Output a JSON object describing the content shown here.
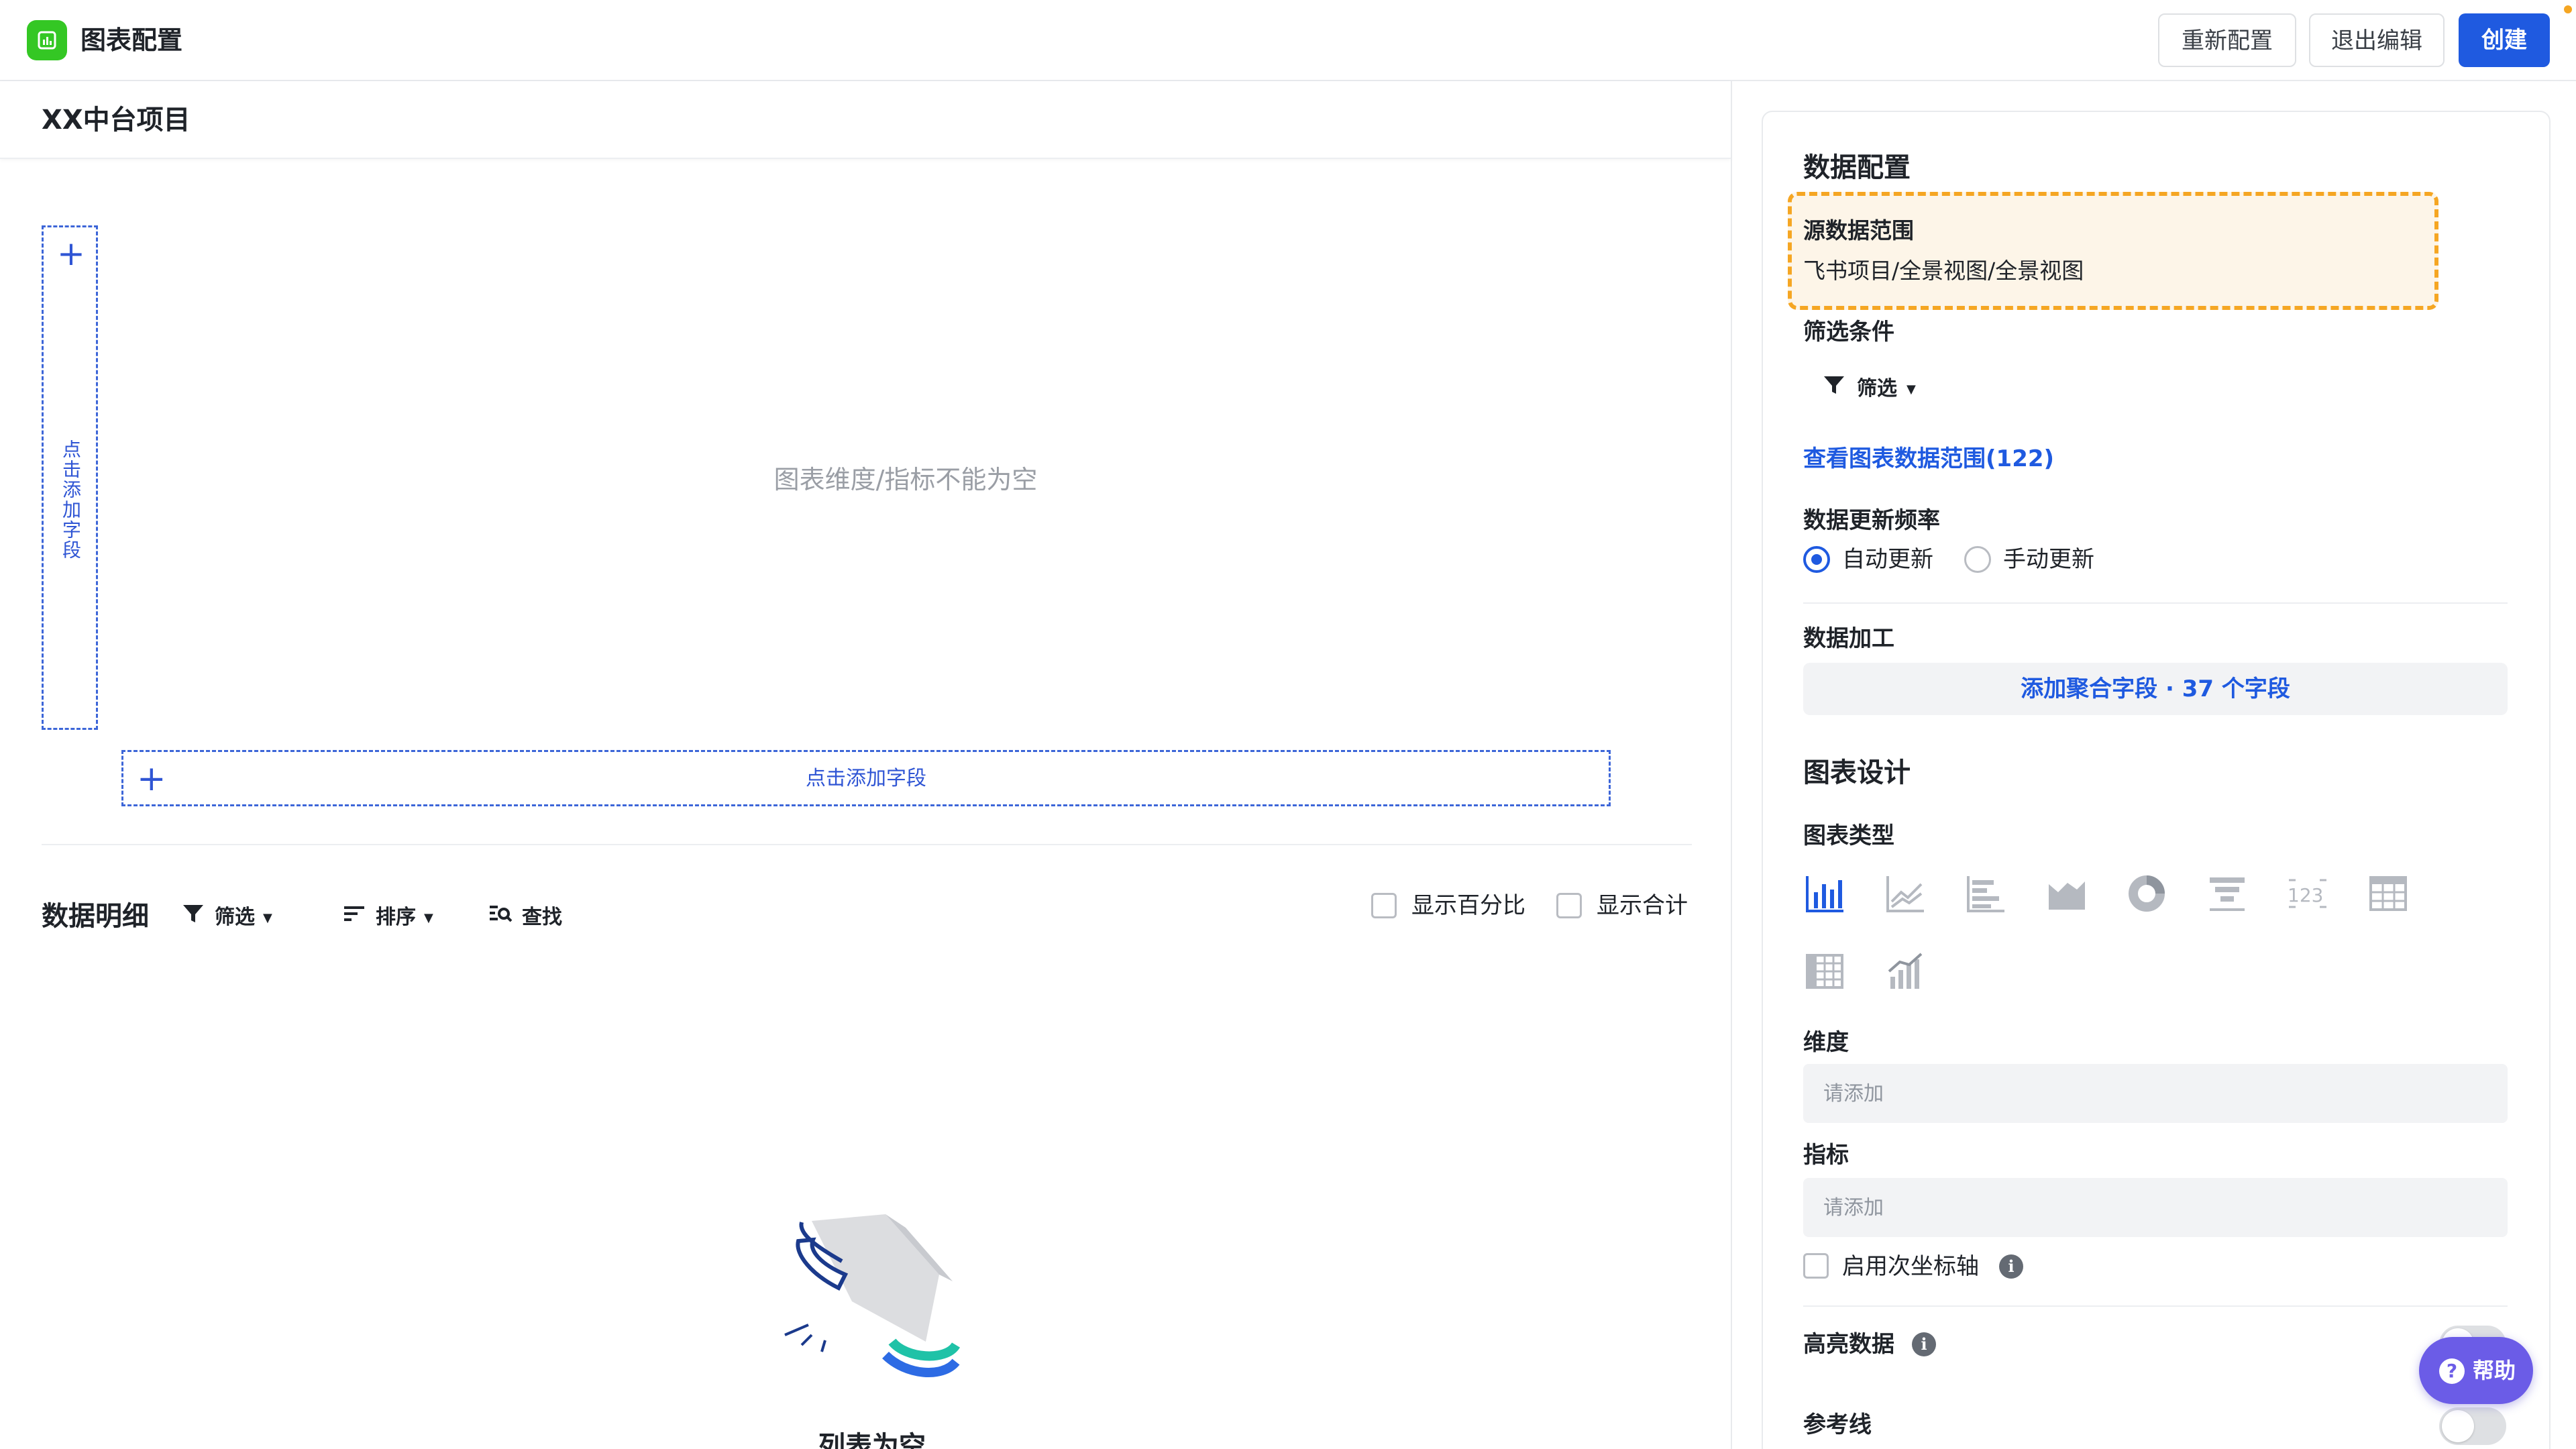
{
  "app": {
    "title": "图表配置"
  },
  "header": {
    "reset_label": "重新配置",
    "exit_label": "退出编辑",
    "create_label": "创建"
  },
  "canvas": {
    "project_title": "XX中台项目",
    "y_field_hint": "点击添加字段",
    "x_field_hint": "点击添加字段",
    "empty_chart_text": "图表维度/指标不能为空"
  },
  "details": {
    "title": "数据明细",
    "filter_label": "筛选",
    "sort_label": "排序",
    "find_label": "查找",
    "show_percent_label": "显示百分比",
    "show_total_label": "显示合计",
    "show_percent_checked": false,
    "show_total_checked": false,
    "empty_list_text": "列表为空"
  },
  "data_config": {
    "title": "数据配置",
    "source_label": "源数据范围",
    "source_value": "飞书项目/全景视图/全景视图",
    "filter_title": "筛选条件",
    "filter_button": "筛选",
    "view_range_link": "查看图表数据范围(122)",
    "update_title": "数据更新频率",
    "update_auto": "自动更新",
    "update_manual": "手动更新",
    "update_selected": "auto",
    "process_title": "数据加工",
    "add_agg_label": "添加聚合字段 · 37 个字段"
  },
  "chart_design": {
    "title": "图表设计",
    "type_title": "图表类型",
    "chart_types": [
      "bar-chart-icon",
      "line-chart-icon",
      "horizontal-bar-chart-icon",
      "area-chart-icon",
      "donut-chart-icon",
      "funnel-chart-icon",
      "number-card-icon",
      "table-icon",
      "pivot-table-icon",
      "combo-chart-icon"
    ],
    "selected_type": "bar-chart-icon",
    "dimension_title": "维度",
    "dimension_placeholder": "请添加",
    "metric_title": "指标",
    "metric_placeholder": "请添加",
    "secondary_axis_label": "启用次坐标轴",
    "highlight_title": "高亮数据",
    "refline_title": "参考线"
  },
  "help": {
    "label": "帮助"
  },
  "colors": {
    "accent": "#1f5ae0",
    "brand_green": "#34c724",
    "highlight_orange": "#f5a623",
    "help_purple": "#6b5ce7"
  }
}
